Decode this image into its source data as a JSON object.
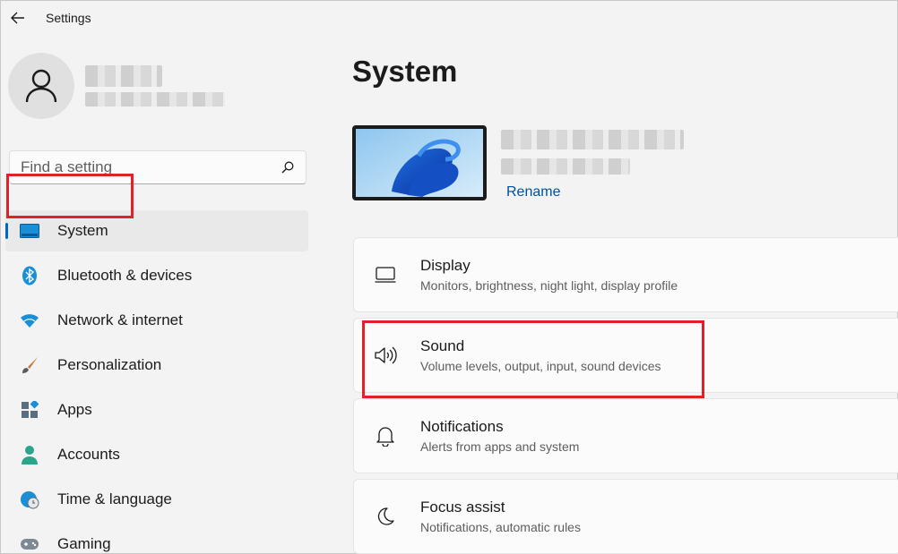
{
  "window": {
    "title": "Settings"
  },
  "search": {
    "placeholder": "Find a setting"
  },
  "sidebar": {
    "items": [
      {
        "label": "System"
      },
      {
        "label": "Bluetooth & devices"
      },
      {
        "label": "Network & internet"
      },
      {
        "label": "Personalization"
      },
      {
        "label": "Apps"
      },
      {
        "label": "Accounts"
      },
      {
        "label": "Time & language"
      },
      {
        "label": "Gaming"
      }
    ]
  },
  "main": {
    "title": "System",
    "rename_label": "Rename",
    "cards": [
      {
        "title": "Display",
        "subtitle": "Monitors, brightness, night light, display profile"
      },
      {
        "title": "Sound",
        "subtitle": "Volume levels, output, input, sound devices"
      },
      {
        "title": "Notifications",
        "subtitle": "Alerts from apps and system"
      },
      {
        "title": "Focus assist",
        "subtitle": "Notifications, automatic rules"
      }
    ]
  },
  "colors": {
    "accent": "#0067c0",
    "highlight_box": "#e1202a",
    "background": "#f3f3f3",
    "card": "#fbfbfb"
  },
  "icons": {
    "back": "back-arrow-icon",
    "avatar": "user-avatar-icon",
    "search": "search-icon",
    "system": "system-display-icon",
    "bluetooth": "bluetooth-icon",
    "network": "wifi-icon",
    "personalization": "paintbrush-icon",
    "apps": "apps-icon",
    "accounts": "account-icon",
    "time": "globe-clock-icon",
    "gaming": "gamepad-icon",
    "display": "monitor-icon",
    "sound": "speaker-icon",
    "notifications": "bell-icon",
    "focus": "moon-icon"
  }
}
